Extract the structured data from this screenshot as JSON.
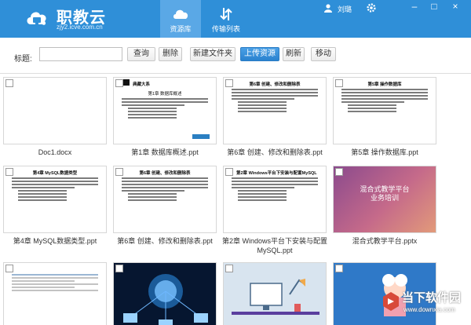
{
  "header": {
    "brand_name": "职教云",
    "brand_url": "zjy2.icve.com.cn",
    "tabs": [
      {
        "label": "资源库",
        "icon": "cloud-icon",
        "active": true
      },
      {
        "label": "传输列表",
        "icon": "transfer-icon",
        "active": false
      }
    ],
    "user_name": "刘璐",
    "window_controls": [
      "minimize",
      "maximize",
      "close"
    ],
    "accent_color": "#2f8fd8"
  },
  "toolbar": {
    "title_label": "标题:",
    "title_value": "",
    "buttons": {
      "query": "查询",
      "delete": "删除",
      "new_folder": "新建文件夹",
      "upload": "上传资源",
      "refresh": "刷新",
      "move": "移动"
    }
  },
  "files": [
    {
      "name": "Doc1.docx"
    },
    {
      "name": "第1章 数据库概述.ppt",
      "heading": "典藏大系",
      "subheading": "第1章 数据库概述"
    },
    {
      "name": "第6章 创建、修改和删除表.ppt",
      "heading": "第6章 创建、修改和删除表"
    },
    {
      "name": "第5章 操作数据库.ppt",
      "heading": "第5章 操作数据库"
    },
    {
      "name": "第4章 MySQL数据类型.ppt",
      "heading": "第4章 MySQL数据类型"
    },
    {
      "name": "第6章 创建、修改和删除表.ppt",
      "heading": "第6章 创建、修改和删除表"
    },
    {
      "name": "第2章 Windows平台下安装与配置MySQL.ppt",
      "heading": "第2章 Windows平台下安装与配置MySQL"
    },
    {
      "name": "混合式教学平台.pptx",
      "slide_title_1": "混合式教学平台",
      "slide_title_2": "业务培训"
    },
    {
      "name": ""
    },
    {
      "name": ""
    },
    {
      "name": ""
    },
    {
      "name": ""
    }
  ],
  "watermark": {
    "text": "当下软件园",
    "url": "www.downxia.com"
  }
}
